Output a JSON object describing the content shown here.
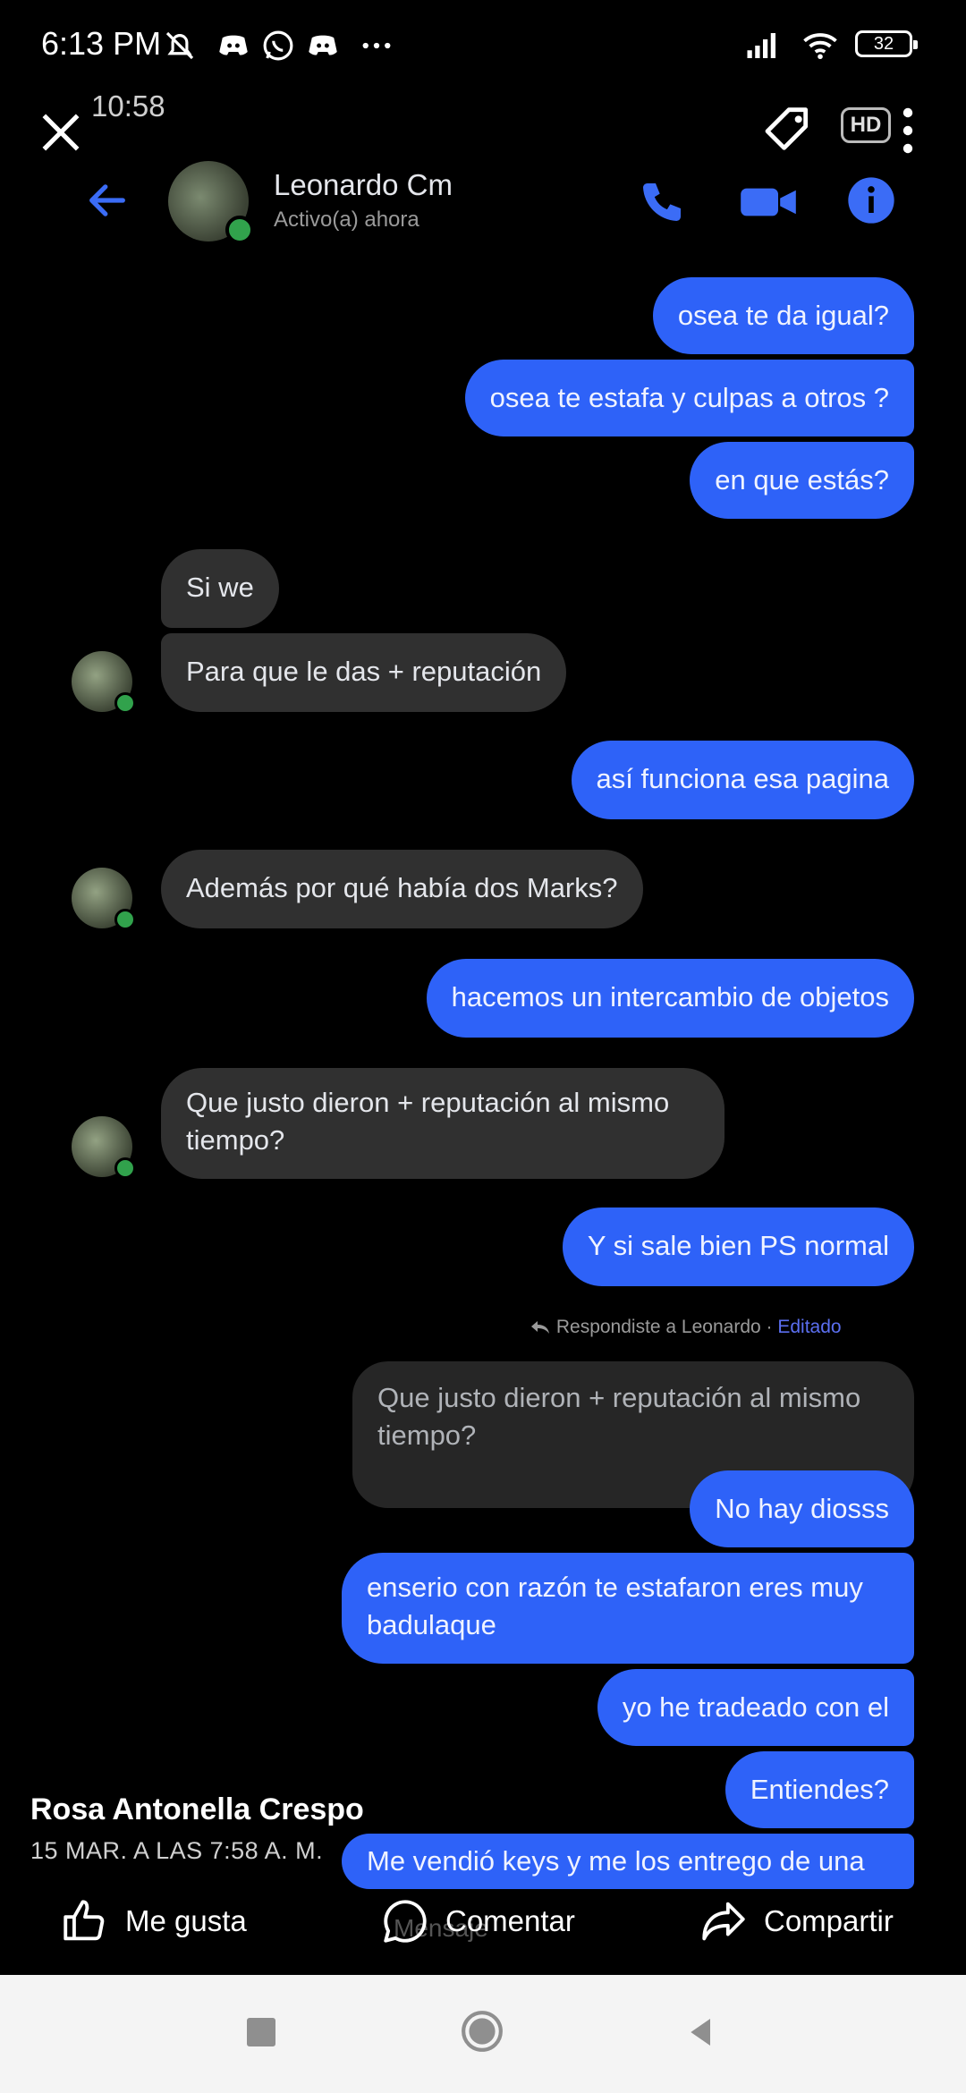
{
  "status_bar": {
    "time": "6:13 PM",
    "battery": "32"
  },
  "screenshot": {
    "inner_time": "10:58",
    "hd_label": "HD",
    "contact": {
      "name": "Leonardo Cm",
      "status": "Activo(a) ahora"
    },
    "messages": [
      {
        "dir": "out",
        "text": "osea te da igual?"
      },
      {
        "dir": "out",
        "text": "osea te estafa y culpas a otros ?"
      },
      {
        "dir": "out",
        "text": "en que estás?"
      },
      {
        "dir": "in",
        "text": "Si we"
      },
      {
        "dir": "in",
        "text": "Para que le das + reputación"
      },
      {
        "dir": "out",
        "text": "así funciona esa pagina"
      },
      {
        "dir": "in",
        "text": "Además por qué había dos Marks?"
      },
      {
        "dir": "out",
        "text": "hacemos un intercambio de objetos"
      },
      {
        "dir": "in",
        "text": "Que justo dieron + reputación al mismo tiempo?"
      },
      {
        "dir": "out",
        "text": "Y si sale bien PS normal"
      },
      {
        "dir": "out",
        "text": "No hay diosss"
      },
      {
        "dir": "out",
        "text": "enserio con razón te estafaron eres muy badulaque"
      },
      {
        "dir": "out",
        "text": "yo he tradeado con el"
      },
      {
        "dir": "out",
        "text": "Entiendes?"
      },
      {
        "dir": "out",
        "text": "Me vendió keys y me los entrego de una"
      }
    ],
    "reply": {
      "meta": "Respondiste a Leonardo ·",
      "edited": "Editado",
      "quoted": "Que justo dieron + reputación al mismo tiempo?"
    },
    "composer_placeholder": "Mensaje"
  },
  "post": {
    "author": "Rosa Antonella Crespo",
    "date": "15 MAR. A LAS 7:58 A. M.",
    "actions": {
      "like": "Me gusta",
      "comment": "Comentar",
      "share": "Compartir"
    }
  },
  "colors": {
    "outgoing": "#2e62f8",
    "incoming": "#303030",
    "accent": "#3b6cf6",
    "online": "#31a24c"
  }
}
